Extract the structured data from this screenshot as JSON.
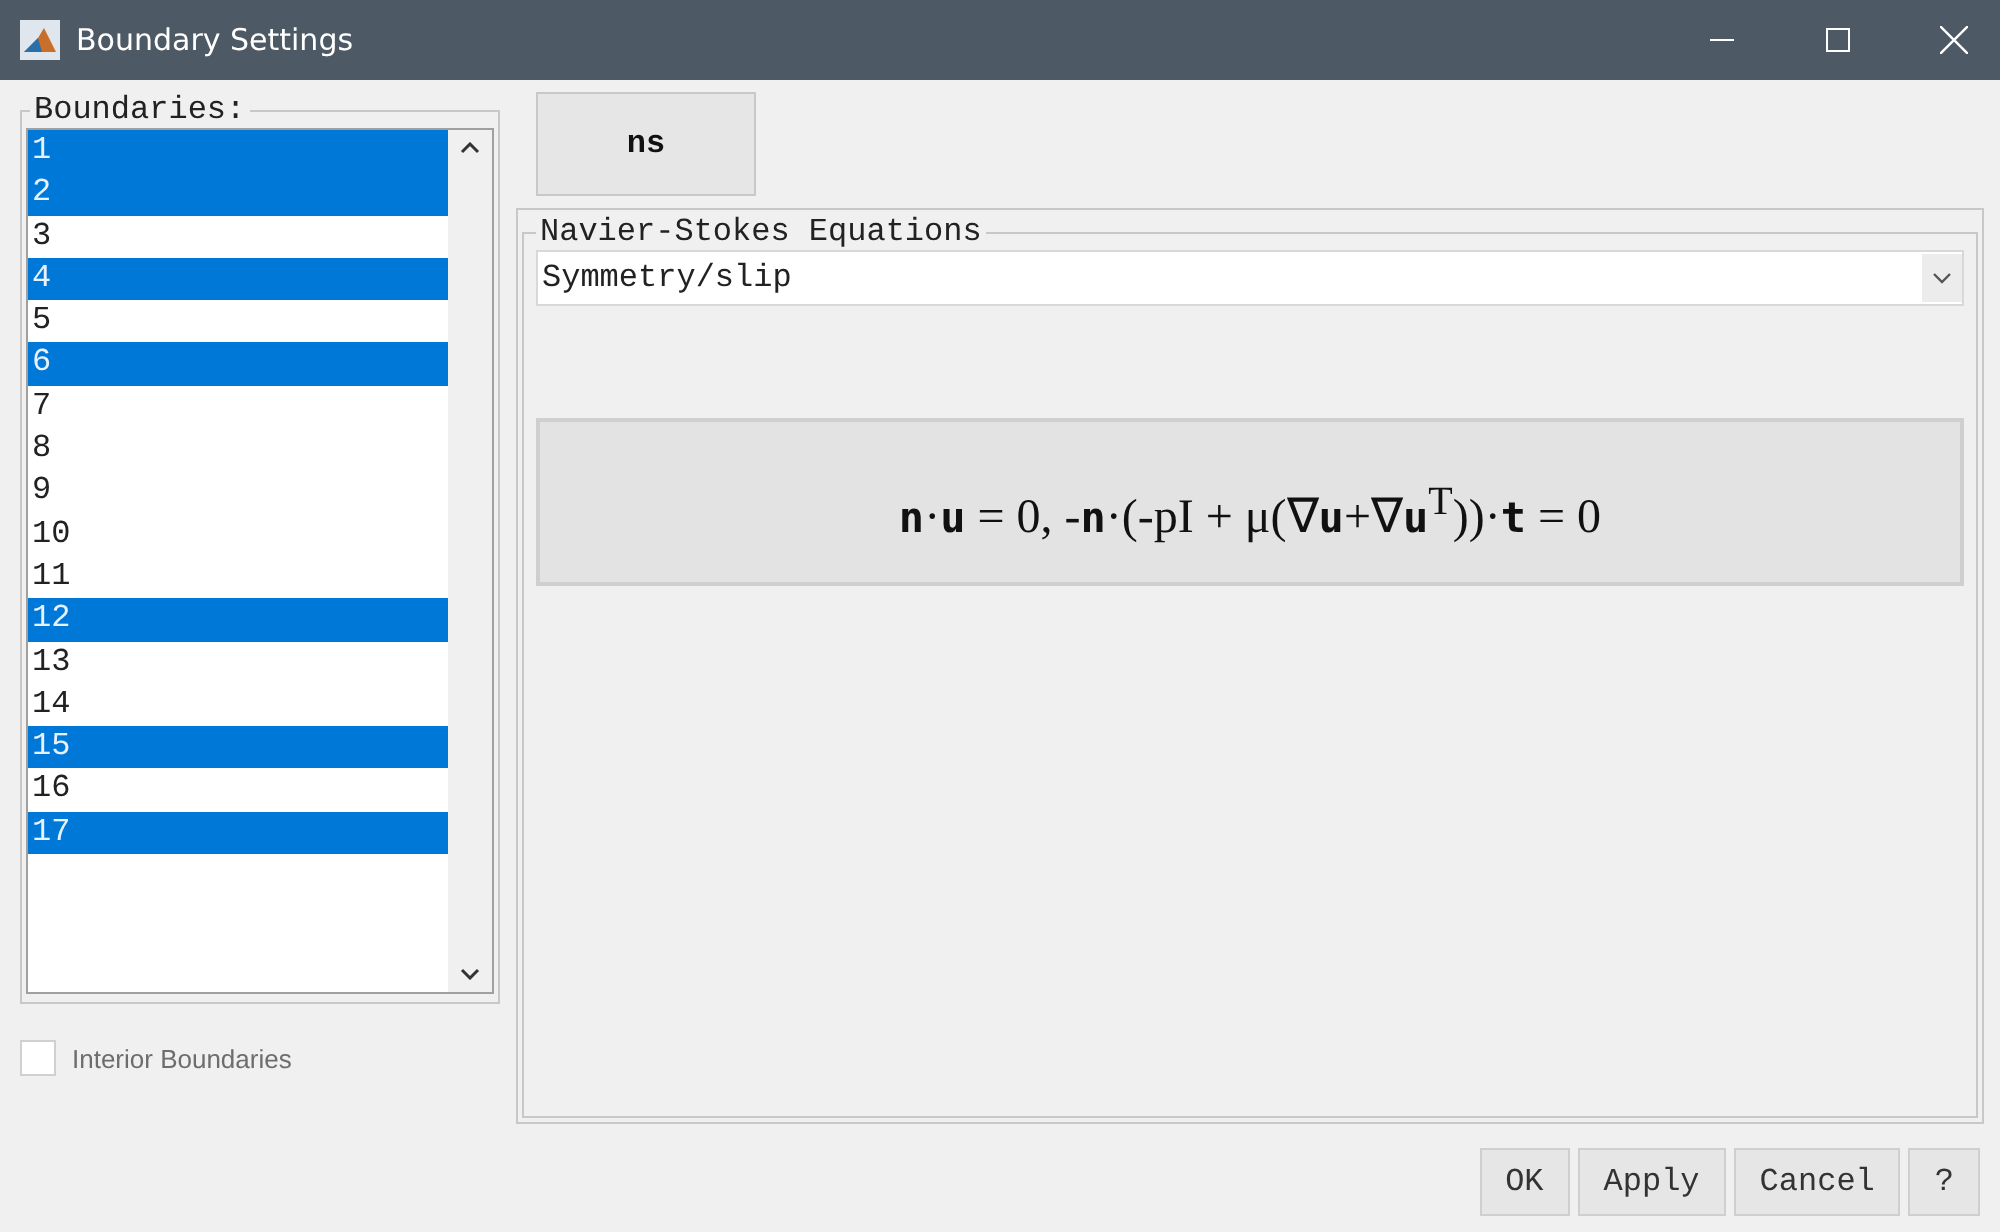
{
  "window": {
    "title": "Boundary Settings"
  },
  "boundaries": {
    "label": "Boundaries:",
    "items": [
      {
        "label": "1",
        "selected": true
      },
      {
        "label": "2",
        "selected": true
      },
      {
        "label": "3",
        "selected": false
      },
      {
        "label": "4",
        "selected": true
      },
      {
        "label": "5",
        "selected": false
      },
      {
        "label": "6",
        "selected": true
      },
      {
        "label": "7",
        "selected": false
      },
      {
        "label": "8",
        "selected": false
      },
      {
        "label": "9",
        "selected": false
      },
      {
        "label": "10",
        "selected": false
      },
      {
        "label": "11",
        "selected": false
      },
      {
        "label": "12",
        "selected": true
      },
      {
        "label": "13",
        "selected": false
      },
      {
        "label": "14",
        "selected": false
      },
      {
        "label": "15",
        "selected": true
      },
      {
        "label": "16",
        "selected": false
      },
      {
        "label": "17",
        "selected": true
      }
    ]
  },
  "interior_boundaries": {
    "label": "Interior Boundaries",
    "checked": false
  },
  "tabs": [
    {
      "label": "ns",
      "selected": true
    }
  ],
  "group": {
    "title": "Navier-Stokes Equations",
    "condition": "Symmetry/slip",
    "equation": "**n**·**u** = 0, -**n**·(-pI + μ(∇**u**+∇**u**$^{T}$))·**t** = 0"
  },
  "buttons": [
    "OK",
    "Apply",
    "Cancel",
    "?"
  ]
}
